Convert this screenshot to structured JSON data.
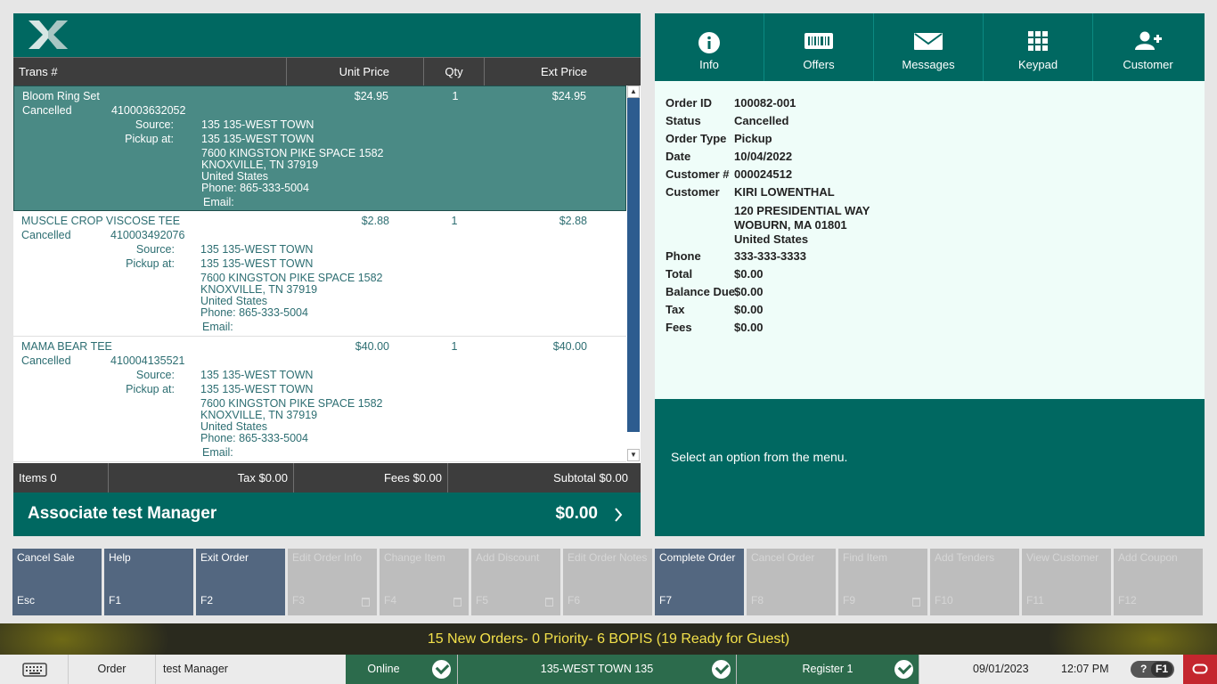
{
  "columns": {
    "trans": "Trans #",
    "unit_price": "Unit Price",
    "qty": "Qty",
    "ext_price": "Ext Price"
  },
  "line_items": [
    {
      "name": "Bloom Ring Set",
      "status": "Cancelled",
      "trans": "410003632052",
      "unit_price": "$24.95",
      "qty": "1",
      "ext_price": "$24.95",
      "source_label": "Source:",
      "source": "135 135-WEST TOWN",
      "pickup_label": "Pickup at:",
      "pickup": "135 135-WEST TOWN",
      "addr1": "7600 KINGSTON PIKE SPACE 1582",
      "addr2": "KNOXVILLE, TN 37919",
      "country": "United States",
      "phone": "Phone: 865-333-5004",
      "email": "Email:"
    },
    {
      "name": "MUSCLE CROP VISCOSE TEE",
      "status": "Cancelled",
      "trans": "410003492076",
      "unit_price": "$2.88",
      "qty": "1",
      "ext_price": "$2.88",
      "source_label": "Source:",
      "source": "135 135-WEST TOWN",
      "pickup_label": "Pickup at:",
      "pickup": "135 135-WEST TOWN",
      "addr1": "7600 KINGSTON PIKE SPACE 1582",
      "addr2": "KNOXVILLE, TN 37919",
      "country": "United States",
      "phone": "Phone: 865-333-5004",
      "email": "Email:"
    },
    {
      "name": "MAMA BEAR TEE",
      "status": "Cancelled",
      "trans": "410004135521",
      "unit_price": "$40.00",
      "qty": "1",
      "ext_price": "$40.00",
      "source_label": "Source:",
      "source": "135 135-WEST TOWN",
      "pickup_label": "Pickup at:",
      "pickup": "135 135-WEST TOWN",
      "addr1": "7600 KINGSTON PIKE SPACE 1582",
      "addr2": "KNOXVILLE, TN 37919",
      "country": "United States",
      "phone": "Phone: 865-333-5004",
      "email": "Email:"
    }
  ],
  "totals": {
    "items": "Items 0",
    "tax": "Tax $0.00",
    "fees": "Fees $0.00",
    "subtotal": "Subtotal $0.00"
  },
  "associate": {
    "label": "Associate test Manager",
    "amount": "$0.00"
  },
  "tabs": [
    {
      "label": "Info",
      "icon": "info-icon"
    },
    {
      "label": "Offers",
      "icon": "barcode-icon"
    },
    {
      "label": "Messages",
      "icon": "envelope-icon"
    },
    {
      "label": "Keypad",
      "icon": "keypad-icon"
    },
    {
      "label": "Customer",
      "icon": "add-user-icon"
    }
  ],
  "order_info": {
    "order_id_label": "Order ID",
    "order_id": "100082-001",
    "status_label": "Status",
    "status": "Cancelled",
    "order_type_label": "Order Type",
    "order_type": "Pickup",
    "date_label": "Date",
    "date": "10/04/2022",
    "customer_num_label": "Customer #",
    "customer_num": "000024512",
    "customer_label": "Customer",
    "customer": "KIRI LOWENTHAL",
    "address1": "120 PRESIDENTIAL WAY",
    "address2": "WOBURN, MA 01801",
    "address3": "United States",
    "phone_label": "Phone",
    "phone": "333-333-3333",
    "total_label": "Total",
    "total": "$0.00",
    "balance_label": "Balance Due",
    "balance": "$0.00",
    "tax_label": "Tax",
    "tax": "$0.00",
    "fees_label": "Fees",
    "fees": "$0.00"
  },
  "message": "Select an option from the menu.",
  "function_keys": [
    {
      "label": "Cancel Sale",
      "key": "Esc",
      "enabled": true
    },
    {
      "label": "Help",
      "key": "F1",
      "enabled": true
    },
    {
      "label": "Exit Order",
      "key": "F2",
      "enabled": true
    },
    {
      "label": "Edit Order Info",
      "key": "F3",
      "enabled": false
    },
    {
      "label": "Change Item",
      "key": "F4",
      "enabled": false
    },
    {
      "label": "Add Discount",
      "key": "F5",
      "enabled": false
    },
    {
      "label": "Edit Order Notes",
      "key": "F6",
      "enabled": false
    },
    {
      "label": "Complete Order",
      "key": "F7",
      "enabled": true
    },
    {
      "label": "Cancel Order",
      "key": "F8",
      "enabled": false
    },
    {
      "label": "Find Item",
      "key": "F9",
      "enabled": false
    },
    {
      "label": "Add Tenders",
      "key": "F10",
      "enabled": false
    },
    {
      "label": "View Customer",
      "key": "F11",
      "enabled": false
    },
    {
      "label": "Add Coupon",
      "key": "F12",
      "enabled": false
    }
  ],
  "banner": "15 New Orders- 0 Priority- 6 BOPIS (19 Ready for Guest)",
  "status_bar": {
    "mode": "Order",
    "user": "test Manager",
    "online": "Online",
    "store": "135-WEST TOWN 135",
    "register": "Register 1",
    "date": "09/01/2023",
    "time": "12:07 PM",
    "help": "?",
    "help_key": "F1"
  },
  "colors": {
    "teal": "#006861",
    "selected_row": "#4a8a85",
    "info_bg": "#effdf9",
    "fkey": "#536780",
    "banner_text": "#f2e04a",
    "status_green": "#2c6b4c"
  }
}
